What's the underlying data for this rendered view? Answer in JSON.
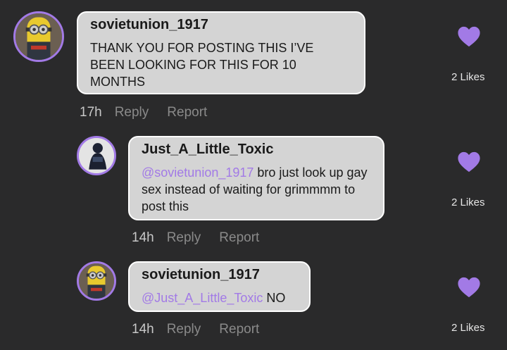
{
  "colors": {
    "background": "#2a2a2b",
    "bubble": "#d4d4d4",
    "accent": "#a27ae6",
    "meta": "#8a8a8a"
  },
  "comments": [
    {
      "username": "sovietunion_1917",
      "mention": "",
      "text": "THANK YOU FOR POSTING THIS I’VE BEEN LOOKING FOR THIS FOR 10 MONTHS",
      "time": "17h",
      "reply_label": "Reply",
      "report_label": "Report",
      "likes": "2 Likes",
      "avatar_icon": "minion-avatar",
      "heart_icon": "heart-icon"
    },
    {
      "username": "Just_A_Little_Toxic",
      "mention": "@sovietunion_1917",
      "text": " bro just look up gay sex instead of waiting for grimmmm to post this",
      "time": "14h",
      "reply_label": "Reply",
      "report_label": "Report",
      "likes": "2 Likes",
      "avatar_icon": "figure-avatar",
      "heart_icon": "heart-icon"
    },
    {
      "username": "sovietunion_1917",
      "mention": "@Just_A_Little_Toxic",
      "text": " NO",
      "time": "14h",
      "reply_label": "Reply",
      "report_label": "Report",
      "likes": "2 Likes",
      "avatar_icon": "minion-avatar",
      "heart_icon": "heart-icon"
    }
  ]
}
